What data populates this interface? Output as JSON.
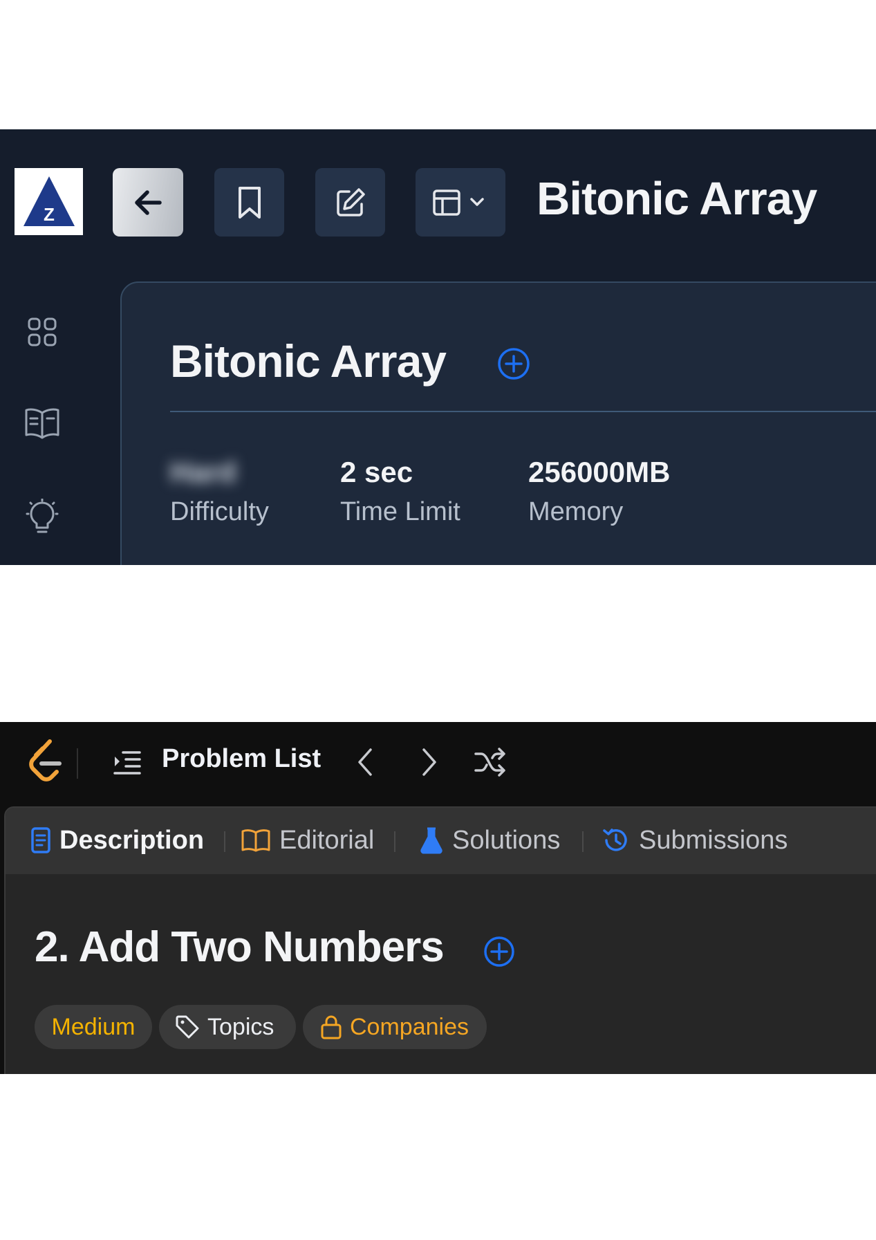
{
  "top_app": {
    "logo_icon": "az-logo-icon",
    "toolbar": {
      "back_icon": "arrow-left-icon",
      "bookmark_icon": "bookmark-icon",
      "edit_icon": "edit-icon",
      "layout_icon": "layout-dropdown-icon"
    },
    "header_title": "Bitonic Array",
    "sidebar_icons": [
      "grid-icon",
      "book-open-icon",
      "lightbulb-icon"
    ],
    "card": {
      "title": "Bitonic Array",
      "add_icon": "plus-circle-icon",
      "stats": [
        {
          "value": "Hard",
          "label": "Difficulty",
          "blurred": true
        },
        {
          "value": "2 sec",
          "label": "Time Limit"
        },
        {
          "value": "256000MB",
          "label": "Memory"
        }
      ]
    },
    "colors": {
      "background": "#151d2c",
      "card": "#1e293b",
      "accent": "#1d6ff2"
    }
  },
  "bottom_app": {
    "problem_list_label": "Problem List",
    "nav_icons": [
      "chevron-left-icon",
      "chevron-right-icon",
      "shuffle-icon"
    ],
    "tabs": [
      {
        "label": "Description",
        "icon": "document-icon",
        "active": true
      },
      {
        "label": "Editorial",
        "icon": "book-icon"
      },
      {
        "label": "Solutions",
        "icon": "flask-icon"
      },
      {
        "label": "Submissions",
        "icon": "history-icon"
      }
    ],
    "problem_title": "2. Add Two Numbers",
    "tags": {
      "difficulty": "Medium",
      "topics": "Topics",
      "companies": "Companies"
    },
    "colors": {
      "background": "#0f0f0f",
      "panel": "#262626",
      "medium": "#f5b300",
      "accent": "#1d6ff2"
    }
  }
}
